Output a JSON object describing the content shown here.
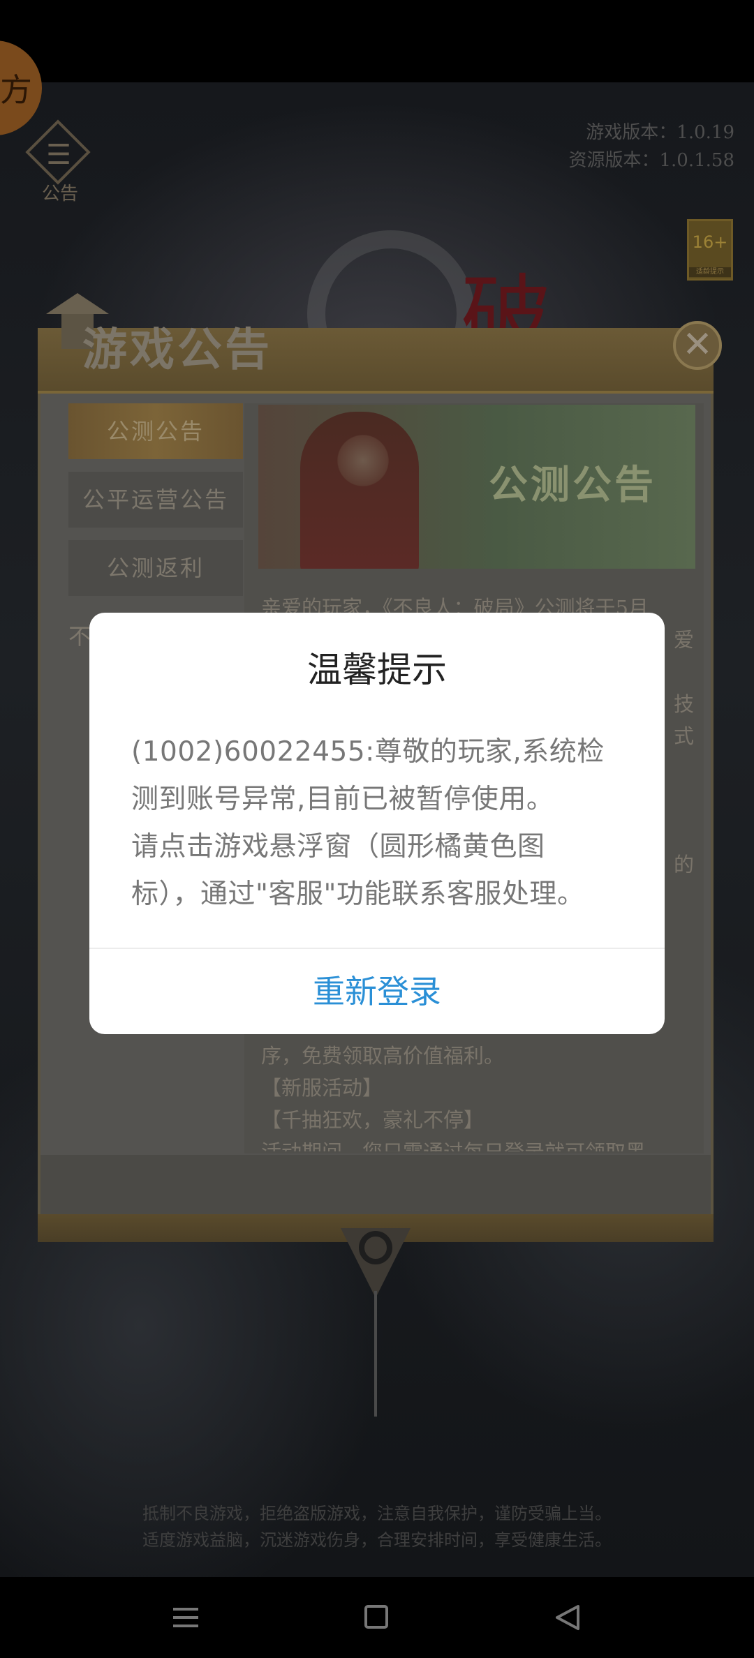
{
  "status": {
    "float_button_char": "方",
    "notice_icon_label": "公告",
    "game_version": "游戏版本：1.0.19",
    "resource_version": "资源版本：1.0.1.58",
    "age_rating": "16+",
    "age_rating_sub": "适龄提示"
  },
  "panel": {
    "title": "游戏公告",
    "tabs": [
      {
        "label": "公测公告",
        "active": true
      },
      {
        "label": "公平运营公告",
        "active": false
      },
      {
        "label": "公测返利",
        "active": false
      },
      {
        "label": "不",
        "active": false
      }
    ],
    "banner_title": "公测公告",
    "article_lines": [
      "亲爱的玩家，《不良人：破局》公测将于5月",
      "爱",
      "",
      "技",
      "式",
      "",
      "的"
    ],
    "tail_lines": [
      "序，免费领取高价值福利。",
      "【新服活动】",
      "【千抽狂欢，豪礼不停】",
      "活动期间，您只需通过每日登录就可领取黑"
    ],
    "health_tip_lines": [
      "抵制不良游戏，拒绝盗版游戏，注意自我保护，谨防受骗上当。",
      "适度游戏益脑，沉迷游戏伤身，合理安排时间，享受健康生活。"
    ]
  },
  "dialog": {
    "title": "温馨提示",
    "message_lines": [
      "(1002)60022455:尊敬的玩家,系统检",
      "测到账号异常,目前已被暂停使用。",
      "请点击游戏悬浮窗（圆形橘黄色图",
      "标），通过\"客服\"功能联系客服处理。"
    ],
    "action_label": "重新登录",
    "action_color": "#2a8fd6"
  },
  "navigation": {
    "icons": [
      "menu-icon",
      "home-icon",
      "back-icon"
    ]
  }
}
